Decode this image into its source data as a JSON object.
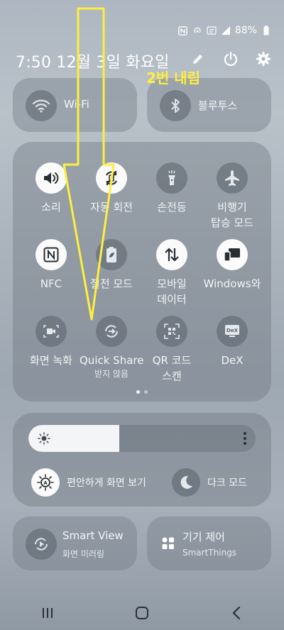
{
  "status_bar": {
    "battery_text": "88%"
  },
  "header": {
    "datetime": "7:50  12월 3일 화요일"
  },
  "annotation": {
    "text": "2번 내림"
  },
  "tiles_top": [
    {
      "label": "Wi-Fi",
      "icon": "wifi-icon"
    },
    {
      "label": "블루투스",
      "icon": "bluetooth-icon"
    }
  ],
  "quick_settings": {
    "row1": [
      {
        "label": "소리",
        "sub": "",
        "icon": "sound-icon",
        "state": "on"
      },
      {
        "label": "자동 회전",
        "sub": "",
        "icon": "auto-rotate-icon",
        "state": "on"
      },
      {
        "label": "손전등",
        "sub": "",
        "icon": "flashlight-icon",
        "state": "off"
      },
      {
        "label": "비행기",
        "sub": "탑승 모드",
        "icon": "airplane-icon",
        "state": "off"
      }
    ],
    "row2": [
      {
        "label": "NFC",
        "sub": "",
        "icon": "nfc-icon",
        "state": "on"
      },
      {
        "label": "절전 모드",
        "sub": "",
        "icon": "battery-saver-icon",
        "state": "off"
      },
      {
        "label": "모바일",
        "sub": "데이터",
        "icon": "mobile-data-icon",
        "state": "on"
      },
      {
        "label": "Windows와",
        "sub": "",
        "icon": "link-to-windows-icon",
        "state": "on"
      }
    ],
    "row3": [
      {
        "label": "화면 녹화",
        "sub": "",
        "icon": "screen-recorder-icon",
        "state": "off"
      },
      {
        "label": "Quick Share",
        "sub": "받지 않음",
        "icon": "quick-share-icon",
        "state": "off"
      },
      {
        "label": "QR 코드",
        "sub": "스캔",
        "icon": "qr-scan-icon",
        "state": "off"
      },
      {
        "label": "DeX",
        "sub": "",
        "icon": "dex-icon",
        "state": "off"
      }
    ]
  },
  "brightness": {
    "level": 0.4
  },
  "comfort": {
    "eye_label": "편안하게 화면 보기",
    "dark_label": "다크 모드"
  },
  "tiles_bottom": [
    {
      "title": "Smart View",
      "sub": "화면 미러링",
      "icon": "smart-view-icon"
    },
    {
      "title": "기기 제어",
      "sub": "SmartThings",
      "icon": "device-control-icon"
    }
  ],
  "colors": {
    "annotation": "#ffef3d",
    "tile_on": "#fbfbfb",
    "tile_off": "#5a626c"
  }
}
